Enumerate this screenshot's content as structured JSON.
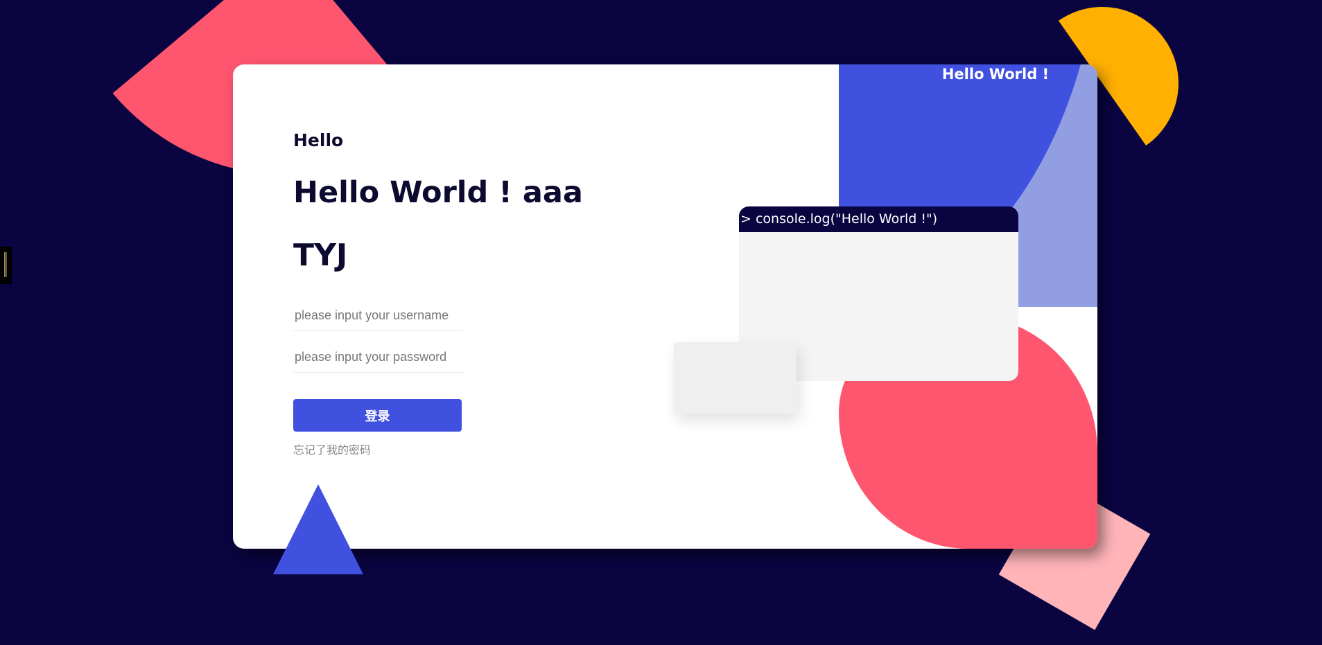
{
  "header": {
    "banner_text": "Hello World !"
  },
  "login": {
    "greeting": "Hello",
    "title": "Hello World ! aaa",
    "subtitle": "TYJ",
    "username_placeholder": "please input your username",
    "password_placeholder": "please input your password",
    "login_button_label": "登录",
    "forgot_password_link": "忘记了我的密码"
  },
  "console": {
    "command_text": "> console.log(\"Hello World !\")"
  },
  "colors": {
    "background": "#0a0440",
    "primary_blue": "#4051e0",
    "light_blue": "#919fe2",
    "pink": "#ff5670",
    "light_pink": "#ffb4b8",
    "yellow": "#ffb000",
    "card": "#ffffff"
  },
  "icons": {
    "triangle": "triangle-shape",
    "side_widget": "side-toolbar-widget"
  }
}
